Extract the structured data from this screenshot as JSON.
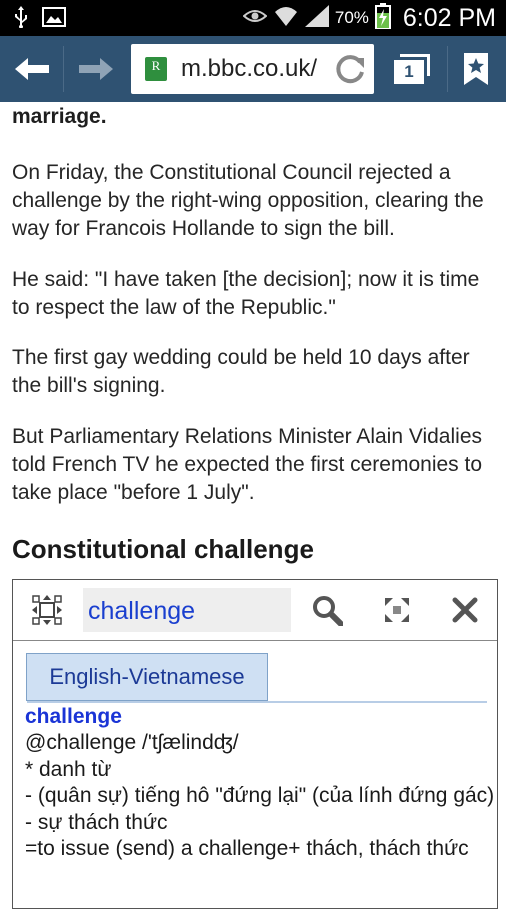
{
  "status_bar": {
    "icons": [
      "usb-icon",
      "gallery-icon",
      "eye-icon",
      "wifi-icon",
      "signal-icon",
      "battery-icon"
    ],
    "battery_percent": "70%",
    "time": "6:02 PM"
  },
  "browser": {
    "url": "m.bbc.co.uk/",
    "tabs_count": "1",
    "colors": {
      "toolbar": "#2f5272"
    }
  },
  "article": {
    "fragment": "marriage.",
    "paragraphs": [
      "On Friday, the Constitutional Council rejected a challenge by the right-wing opposition, clearing the way for Francois Hollande to sign the bill.",
      "He said: \"I have taken [the decision]; now it is time to respect the law of the Republic.\"",
      "The first gay wedding could be held 10 days after the bill's signing.",
      "But Parliamentary Relations Minister Alain Vidalies told French TV he expected the first ceremonies to take place \"before 1 July\"."
    ],
    "heading": "Constitutional challenge"
  },
  "dictionary": {
    "search_value": "challenge",
    "tab": "English-Vietnamese",
    "headword": "challenge",
    "lines": [
      "@challenge /'tʃælindʤ/",
      "* danh từ",
      "- (quân sự) tiếng hô \"đứng lại\" (của lính đứng gác)",
      "- sự thách thức",
      "=to issue (send) a challenge+ thách, thách thức"
    ],
    "colors": {
      "accent": "#1a34d6",
      "tab_bg": "#cfe0f3"
    }
  }
}
